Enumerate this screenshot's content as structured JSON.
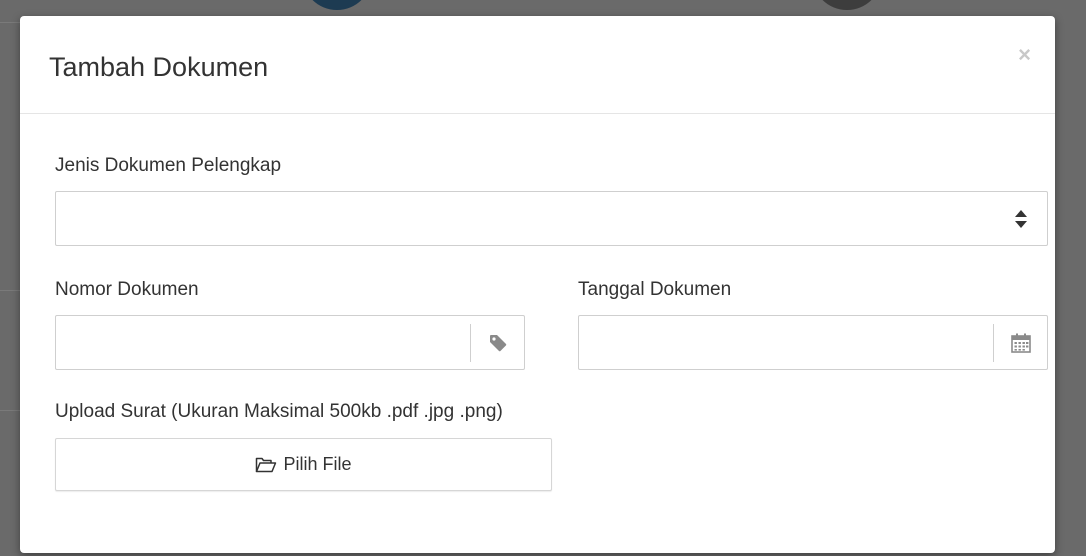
{
  "modal": {
    "title": "Tambah Dokumen",
    "close_label": "×"
  },
  "form": {
    "jenis_label": "Jenis Dokumen Pelengkap",
    "jenis_value": "",
    "nomor_label": "Nomor Dokumen",
    "nomor_value": "",
    "tanggal_label": "Tanggal Dokumen",
    "tanggal_value": "",
    "upload_label": "Upload Surat (Ukuran Maksimal 500kb .pdf .jpg .png)",
    "file_button_label": "Pilih File"
  },
  "icons": {
    "select": "sort-arrows-icon",
    "nomor": "tag-icon",
    "tanggal": "calendar-icon",
    "file": "folder-open-icon"
  },
  "colors": {
    "text": "#333333",
    "border": "#cfcfcf",
    "icon": "#8a8a8a"
  }
}
